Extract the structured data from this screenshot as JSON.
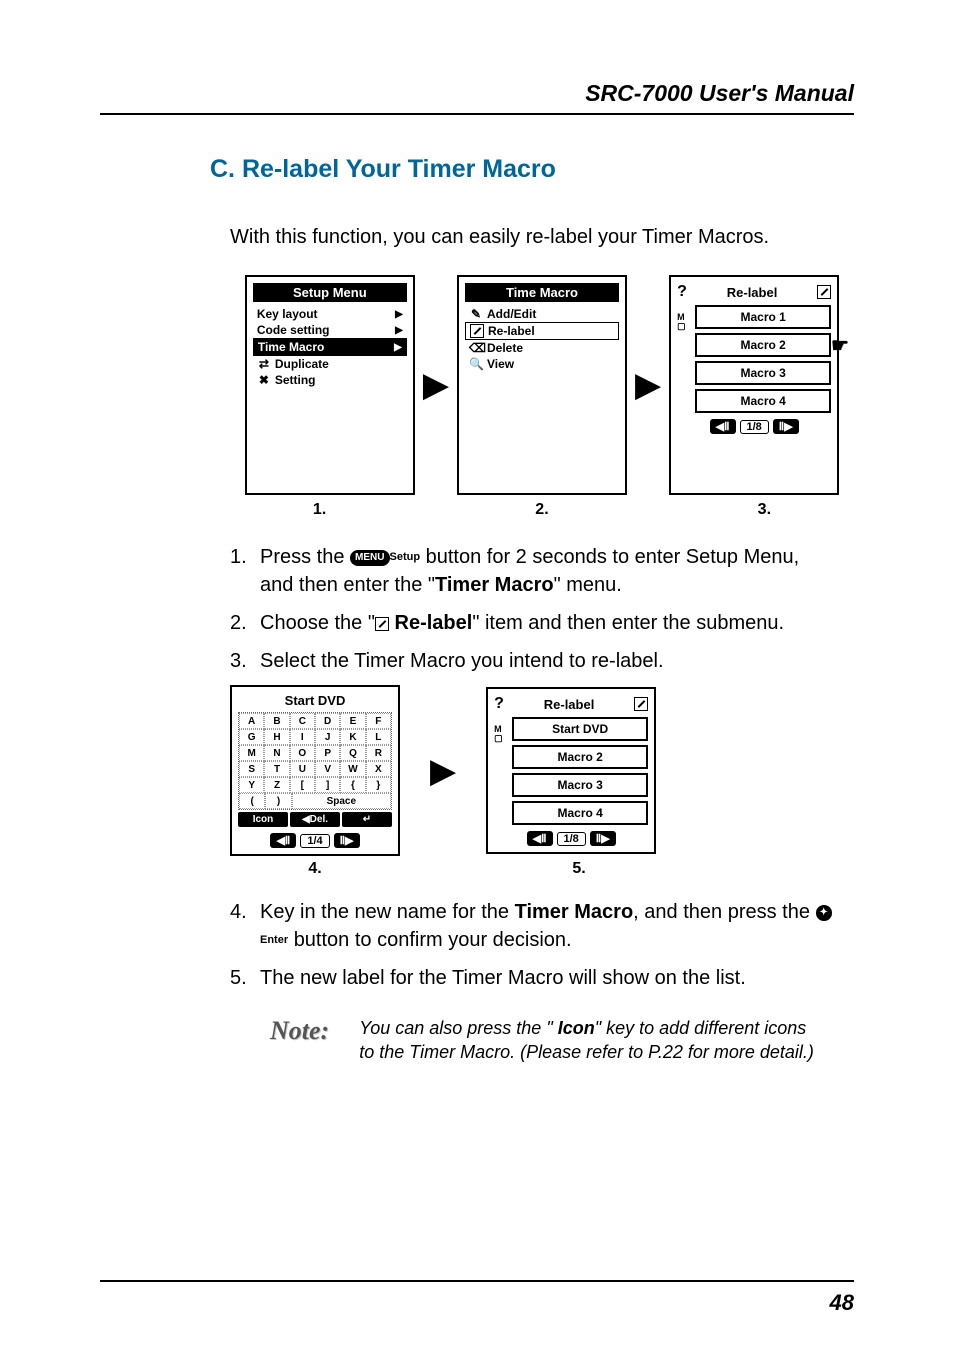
{
  "header": {
    "title": "SRC-7000 User's Manual"
  },
  "section": {
    "title": "C.  Re-label Your Timer Macro"
  },
  "intro": "With this function, you can easily re-label your Timer Macros.",
  "screens": {
    "s1": {
      "title": "Setup Menu",
      "items": [
        "Key layout",
        "Code setting",
        "Time Macro",
        "Duplicate",
        "Setting"
      ],
      "caption": "1."
    },
    "s2": {
      "title": "Time Macro",
      "items": [
        "Add/Edit",
        "Re-label",
        "Delete",
        "View"
      ],
      "caption": "2."
    },
    "s3": {
      "title": "Re-label",
      "items": [
        "Macro 1",
        "Macro 2",
        "Macro 3",
        "Macro 4"
      ],
      "pager": "1/8",
      "caption": "3."
    },
    "s4": {
      "title": "Start  DVD",
      "row1": [
        "A",
        "B",
        "C",
        "D",
        "E",
        "F"
      ],
      "row2": [
        "G",
        "H",
        "I",
        "J",
        "K",
        "L"
      ],
      "row3": [
        "M",
        "N",
        "O",
        "P",
        "Q",
        "R"
      ],
      "row4": [
        "S",
        "T",
        "U",
        "V",
        "W",
        "X"
      ],
      "row5": [
        "Y",
        "Z",
        "[",
        "]",
        "{",
        "}"
      ],
      "row6_1": "(",
      "row6_2": ")",
      "row6_space": "Space",
      "btn_icon": "Icon",
      "btn_del": "Del.",
      "pager": "1/4",
      "caption": "4."
    },
    "s5": {
      "title": "Re-label",
      "items": [
        "Start  DVD",
        "Macro 2",
        "Macro 3",
        "Macro 4"
      ],
      "pager": "1/8",
      "caption": "5."
    }
  },
  "steps": {
    "n1": "1.",
    "t1a": "Press the ",
    "t1_icon_label": "Setup",
    "t1b": " button for 2 seconds to enter Setup Menu, and then enter the \"",
    "t1_bold": "Timer Macro",
    "t1c": "\" menu.",
    "n2": "2.",
    "t2a": "Choose the \"",
    "t2_bold": " Re-label",
    "t2b": "\" item and then enter the submenu.",
    "n3": "3.",
    "t3": "Select the Timer Macro you intend to re-label.",
    "n4": "4.",
    "t4a": "Key in the new name for the ",
    "t4_bold": "Timer Macro",
    "t4b": ", and then press the ",
    "t4_icon_label": "Enter",
    "t4c": " button to confirm your decision.",
    "n5": "5.",
    "t5": "The new label for the Timer Macro will show on the list."
  },
  "note": {
    "label": "Note:",
    "text_a": "You can also press the \" ",
    "text_bold": "Icon",
    "text_b": "\" key to add different icons to the Timer Macro. (Please refer to P.22 for more detail.)"
  },
  "page_number": "48"
}
